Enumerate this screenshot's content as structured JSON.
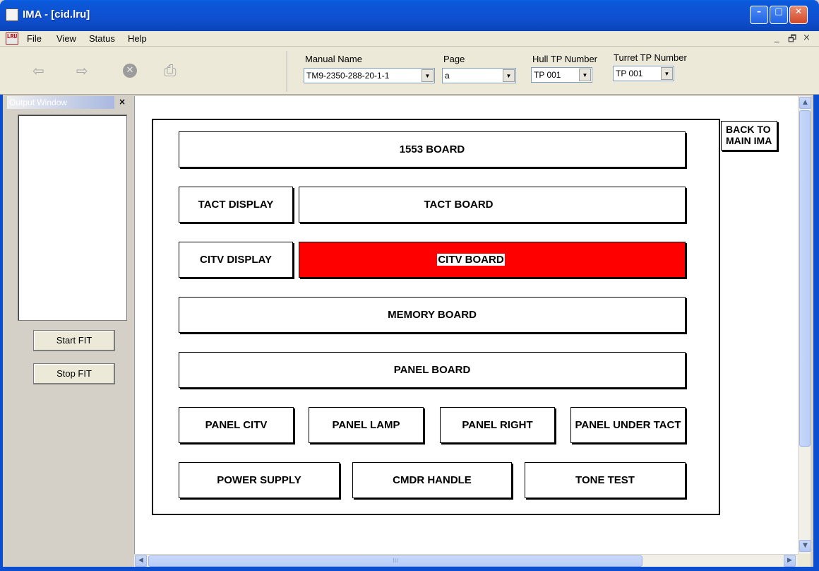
{
  "window": {
    "title": "IMA - [cid.lru]",
    "minimize_glyph": "–",
    "maximize_glyph": "□",
    "close_glyph": "✕"
  },
  "menu": {
    "doc_icon_text": "LRU",
    "items": [
      "File",
      "View",
      "Status",
      "Help"
    ],
    "mdi_minimize": "_",
    "mdi_restore": "🗗",
    "mdi_close": "×"
  },
  "toolbar": {
    "back_glyph": "⇦",
    "forward_glyph": "⇨",
    "stop_glyph": "✕",
    "print_glyph": "⎙",
    "manual_name_label": "Manual Name",
    "manual_name_value": "TM9-2350-288-20-1-1",
    "page_label": "Page",
    "page_value": "a",
    "hull_tp_label": "Hull TP Number",
    "hull_tp_value": "TP 001",
    "turret_tp_label": "Turret TP Number",
    "turret_tp_value": "TP 001",
    "dropdown_glyph": "▼"
  },
  "output_panel": {
    "title": "Output Window",
    "close_glyph": "×",
    "start_fit": "Start FIT",
    "stop_fit": "Stop FIT"
  },
  "diagram": {
    "back_to_main": "BACK TO MAIN IMA",
    "boards": {
      "b1553": "1553 BOARD",
      "tact_display": "TACT DISPLAY",
      "tact_board": "TACT BOARD",
      "citv_display": "CITV DISPLAY",
      "citv_board": "CITV BOARD",
      "memory_board": "MEMORY BOARD",
      "panel_board": "PANEL BOARD",
      "panel_citv": "PANEL CITV",
      "panel_lamp": "PANEL LAMP",
      "panel_right": "PANEL RIGHT",
      "panel_under_tact": "PANEL UNDER TACT",
      "power_supply": "POWER SUPPLY",
      "cmdr_handle": "CMDR HANDLE",
      "tone_test": "TONE TEST"
    },
    "selected_color": "#fe0000"
  },
  "scrollbars": {
    "up": "▲",
    "down": "▼",
    "left": "◀",
    "right": "▶",
    "grip": "III"
  }
}
